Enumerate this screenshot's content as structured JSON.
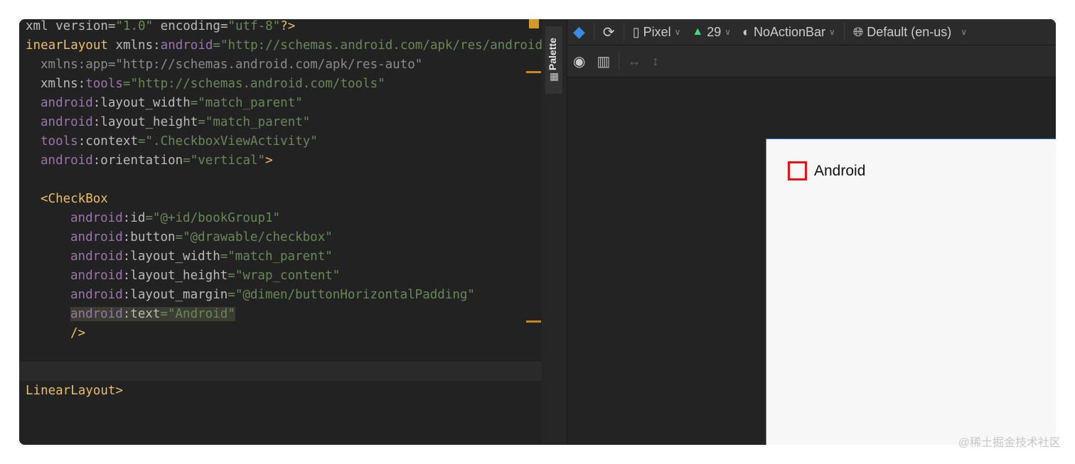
{
  "editor": {
    "lines": [
      {
        "indent": 0,
        "tokens": [
          [
            "xml version=",
            "attr"
          ],
          [
            "\"1.0\"",
            "val"
          ],
          [
            " encoding=",
            "attr"
          ],
          [
            "\"utf-8\"",
            "val"
          ],
          [
            "?>",
            "tag"
          ]
        ]
      },
      {
        "indent": 0,
        "tokens": [
          [
            "inearLayout ",
            "tag"
          ],
          [
            "xmlns:",
            "attr"
          ],
          [
            "android",
            "ns"
          ],
          [
            "=\"http://schemas.android.com/apk/res/android",
            "val"
          ]
        ]
      },
      {
        "indent": 1,
        "tokens": [
          [
            "xmlns:app=\"http://schemas.android.com/apk/res-auto\"",
            "dim"
          ]
        ]
      },
      {
        "indent": 1,
        "tokens": [
          [
            "xmlns:",
            "attr"
          ],
          [
            "tools",
            "ns"
          ],
          [
            "=\"http://schemas.android.com/tools\"",
            "val"
          ]
        ]
      },
      {
        "indent": 1,
        "tokens": [
          [
            "android",
            "ns"
          ],
          [
            ":layout_width",
            "attr"
          ],
          [
            "=\"match_parent\"",
            "val"
          ]
        ]
      },
      {
        "indent": 1,
        "tokens": [
          [
            "android",
            "ns"
          ],
          [
            ":layout_height",
            "attr"
          ],
          [
            "=\"match_parent\"",
            "val"
          ]
        ]
      },
      {
        "indent": 1,
        "tokens": [
          [
            "tools",
            "ns"
          ],
          [
            ":context",
            "attr"
          ],
          [
            "=\".CheckboxViewActivity\"",
            "val"
          ]
        ]
      },
      {
        "indent": 1,
        "tokens": [
          [
            "android",
            "ns"
          ],
          [
            ":orientation",
            "attr"
          ],
          [
            "=\"vertical\"",
            "val"
          ],
          [
            ">",
            "tag"
          ]
        ]
      },
      {
        "indent": 0,
        "tokens": []
      },
      {
        "indent": 1,
        "tokens": [
          [
            "<CheckBox",
            "tag"
          ]
        ]
      },
      {
        "indent": 3,
        "tokens": [
          [
            "android",
            "ns"
          ],
          [
            ":id",
            "attr"
          ],
          [
            "=\"@+id/bookGroup1\"",
            "val"
          ]
        ]
      },
      {
        "indent": 3,
        "tokens": [
          [
            "android",
            "ns"
          ],
          [
            ":button",
            "attr"
          ],
          [
            "=\"@drawable/checkbox\"",
            "val"
          ]
        ]
      },
      {
        "indent": 3,
        "tokens": [
          [
            "android",
            "ns"
          ],
          [
            ":layout_width",
            "attr"
          ],
          [
            "=\"match_parent\"",
            "val"
          ]
        ]
      },
      {
        "indent": 3,
        "tokens": [
          [
            "android",
            "ns"
          ],
          [
            ":layout_height",
            "attr"
          ],
          [
            "=\"wrap_content\"",
            "val"
          ]
        ]
      },
      {
        "indent": 3,
        "tokens": [
          [
            "android",
            "ns"
          ],
          [
            ":layout_margin",
            "attr"
          ],
          [
            "=\"@dimen/buttonHorizontalPadding\"",
            "val"
          ]
        ]
      },
      {
        "indent": 3,
        "hl": true,
        "tokens": [
          [
            "android",
            "ns"
          ],
          [
            ":text",
            "attr"
          ],
          [
            "=\"Android\"",
            "val"
          ]
        ]
      },
      {
        "indent": 3,
        "tokens": [
          [
            "/>",
            "tag"
          ]
        ]
      },
      {
        "indent": 0,
        "tokens": []
      },
      {
        "indent": 0,
        "tokens": []
      },
      {
        "indent": 0,
        "tokens": [
          [
            "LinearLayout>",
            "tag"
          ]
        ]
      }
    ]
  },
  "sidebar": {
    "palette": "Palette"
  },
  "toolbar": {
    "device": "Pixel",
    "api": "29",
    "theme": "NoActionBar",
    "locale": "Default (en-us)"
  },
  "preview": {
    "checkbox_label": "Android"
  },
  "watermark": "@稀土掘金技术社区",
  "colors": {
    "android_green": "#3ddc84",
    "selection": "#3d7be0",
    "checkbox_border": "#e11111"
  }
}
